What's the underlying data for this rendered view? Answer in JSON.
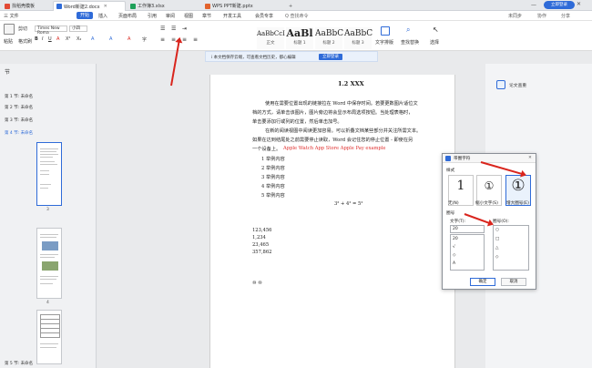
{
  "tabs": {
    "items": [
      {
        "label": "找稻壳模板",
        "color": "#e24a35"
      },
      {
        "label": "Word新建2.docx",
        "color": "#2f6bd8"
      },
      {
        "label": "工作簿3.xlsx",
        "color": "#1fa15a"
      },
      {
        "label": "WPS PPT新建.pptx",
        "color": "#e2632d"
      }
    ],
    "new_tab": "+",
    "register_button": "立即登录",
    "window_controls": [
      "—",
      "□",
      "✕"
    ]
  },
  "menu": {
    "items": [
      "三 文件",
      "开始",
      "插入",
      "页面布局",
      "引用",
      "审阅",
      "视图",
      "章节",
      "开发工具",
      "会员专享"
    ],
    "search": "Q 查找命令",
    "right": [
      "未同步",
      "协作",
      "分享"
    ]
  },
  "ribbon": {
    "paste": "粘贴",
    "cut": "剪切",
    "format_painter": "格式刷",
    "font_name": "Times New Roma",
    "font_size": "小四",
    "styles": [
      {
        "sample": "AaBbCcI",
        "label": "正文"
      },
      {
        "sample": "AaBl",
        "label": "标题 1"
      },
      {
        "sample": "AaBbC",
        "label": "标题 2"
      },
      {
        "sample": "AaBbC",
        "label": "标题 3"
      }
    ],
    "text_layout": "文字排版",
    "find_replace": "查找替换",
    "select": "选择"
  },
  "notice": {
    "text": "i 本文档保存云端，可查看文档历史，都心编辑",
    "button": "立即登录"
  },
  "sidebar": {
    "title": "节",
    "sections": [
      "第 1 节: 未命名",
      "第 2 节: 未命名",
      "第 3 节: 未命名",
      "第 4 节: 未命名",
      "第 5 节: 未命名"
    ],
    "page_numbers": [
      "3",
      "4"
    ]
  },
  "document": {
    "heading": "1.2 XXX",
    "para1": [
      "使用在需要位置出现的链接拉在 Word 中保存时间。若要更数图片适位文",
      "档的方式，请单击该图片，图片旁边将会显示布局选项按钮。当处理表格时，",
      "单击要添加行或列的位置，然后单击加号。"
    ],
    "para2": [
      "在新的阅读视图中阅读更加容易。可以折叠文档某些部分并关注所需文本。",
      "如果在达到结尾处之前需要停止读取，Word 会记住您的停止位置 - 即使在另",
      "一个设备上。"
    ],
    "inline_red": "Apple Watch    App Store    Apple Pay    example",
    "list": [
      "1  举例内容",
      "2  举例内容",
      "3  举例内容",
      "4  举例内容",
      "5  举例内容"
    ],
    "formula": "3² + 4² = 5²",
    "numbers": [
      "123,456",
      "1,234",
      "23,465",
      "357,862"
    ],
    "bottom": "⑩  ⑩"
  },
  "rightrail": {
    "button": "论文查重"
  },
  "dialog": {
    "title": "带圈字符",
    "style_label": "样式",
    "style_options": [
      {
        "glyph": "1",
        "label": "无(N)"
      },
      {
        "glyph": "①",
        "label": "缩小文字(S)"
      },
      {
        "glyph": "①",
        "label": "增大圈号(E)"
      }
    ],
    "circle_label": "圈号",
    "text_label": "文字(T):",
    "circle_sign_label": "圈号(O):",
    "text_value": "20",
    "text_items": [
      "20",
      "√",
      "◇",
      "A"
    ],
    "circle_items": [
      "○",
      "□",
      "△",
      "◇"
    ],
    "ok": "确定",
    "cancel": "取消",
    "close": "✕"
  },
  "colors": {
    "accent": "#2f6bd8",
    "annotation": "#d9251d"
  }
}
